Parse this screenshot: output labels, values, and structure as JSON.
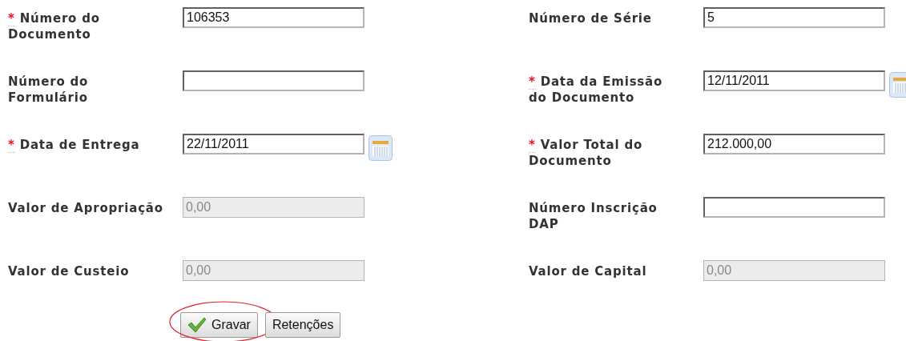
{
  "form": {
    "left_fields": [
      {
        "label": "Número do Documento",
        "value": "106353",
        "required": true,
        "disabled": false,
        "kind": "text"
      },
      {
        "label": "Número do Formulário",
        "required": false,
        "disabled": false,
        "kind": "text"
      },
      {
        "label": "Data de Entrega",
        "value": "22/11/2011",
        "required": true,
        "disabled": false,
        "kind": "date"
      },
      {
        "label": "Valor de Apropriação",
        "value": "0,00",
        "required": false,
        "disabled": true,
        "kind": "text"
      },
      {
        "label": "Valor de Custeio",
        "value": "0,00",
        "required": false,
        "disabled": true,
        "kind": "text"
      }
    ],
    "right_fields": [
      {
        "label": "Número de Série",
        "value": "5",
        "required": false,
        "disabled": false,
        "kind": "text"
      },
      {
        "label": "Data da Emissão do Documento",
        "value": "12/11/2011",
        "required": true,
        "disabled": false,
        "kind": "date"
      },
      {
        "label": "Valor Total do Documento",
        "value": "212.000,00",
        "required": true,
        "disabled": false,
        "kind": "text"
      },
      {
        "label": "Número Inscrição DAP",
        "required": false,
        "disabled": false,
        "kind": "text"
      },
      {
        "label": "Valor de Capital",
        "value": "0,00",
        "required": false,
        "disabled": true,
        "kind": "text"
      }
    ]
  },
  "buttons": [
    {
      "label": "Gravar",
      "kind": "save",
      "highlighted": true
    },
    {
      "label": "Retenções",
      "kind": "plain",
      "highlighted": false
    }
  ],
  "required_mark": "*"
}
